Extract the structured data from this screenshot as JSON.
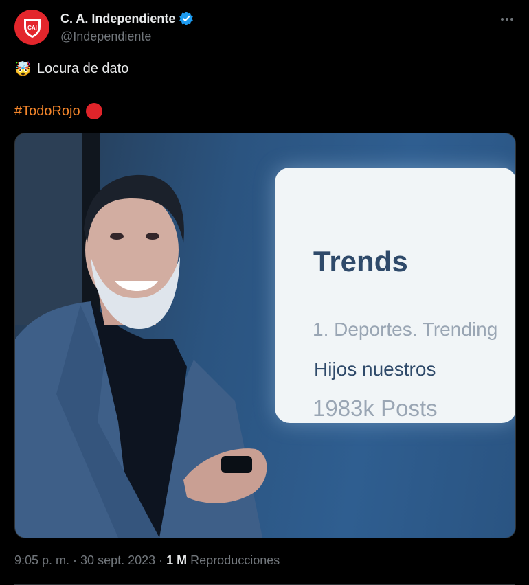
{
  "account": {
    "display_name": "C. A. Independiente",
    "handle": "@Independiente",
    "avatar_text": "CAI",
    "brand_color": "#e3262c",
    "verified_color": "#1d9bf0"
  },
  "tweet": {
    "text": "Locura de dato",
    "emoji": "🤯",
    "hashtag": "#TodoRojo",
    "hashtag_color": "#f4862b"
  },
  "media": {
    "card_title": "Trends",
    "card_line1": "1. Deportes. Trending",
    "card_line2": "Hijos nuestros",
    "card_line3": "1983k Posts"
  },
  "meta": {
    "time": "9:05 p. m.",
    "sep1": " · ",
    "date": "30 sept. 2023",
    "sep2": " · ",
    "views_count": "1 M",
    "views_label": "Reproducciones"
  }
}
